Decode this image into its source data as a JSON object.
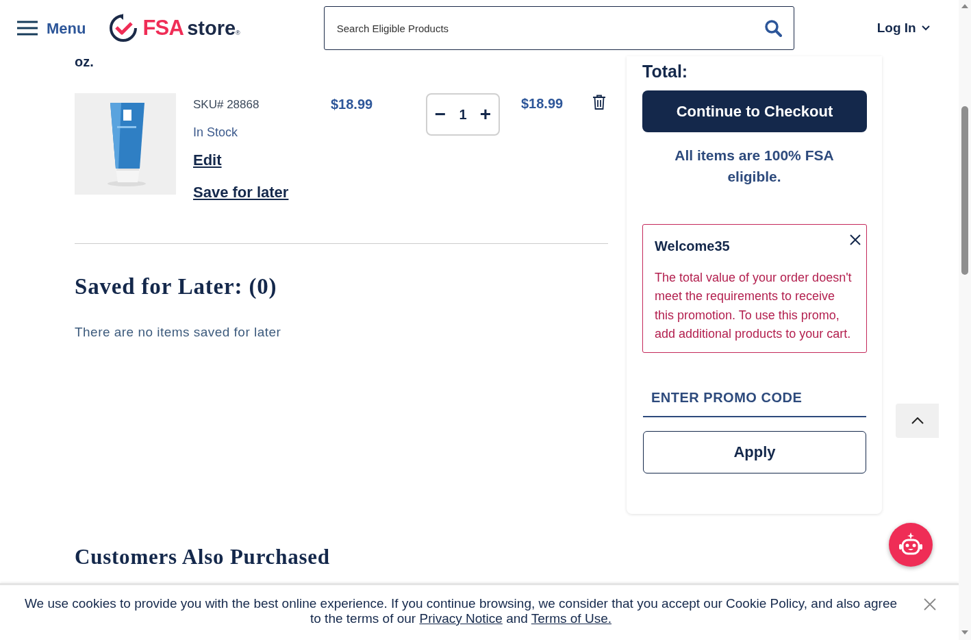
{
  "header": {
    "menu_label": "Menu",
    "logo": {
      "brand": "FSA",
      "word": "store",
      "mark": "®"
    },
    "search": {
      "placeholder": "Search Eligible Products"
    },
    "login_label": "Log In"
  },
  "cart": {
    "title_tail": "oz.",
    "items": [
      {
        "sku": "SKU# 28868",
        "stock": "In Stock",
        "edit": "Edit",
        "save_for_later": "Save for later",
        "price": "$18.99",
        "quantity": "1",
        "decrement": "−",
        "increment": "+",
        "total": "$18.99"
      }
    ]
  },
  "saved_for_later": {
    "title": "Saved for Later: (0)",
    "empty_message": "There are no items saved for later"
  },
  "related": {
    "title": "Customers Also Purchased"
  },
  "summary": {
    "total_label": "Total:",
    "checkout_button": "Continue to Checkout",
    "eligibility_note": "All items are 100% FSA eligible.",
    "promo_alert": {
      "code": "Welcome35",
      "message": "The total value of your order doesn't meet the requirements to receive this promotion. To use this promo, add additional products to your cart."
    },
    "promo_field": {
      "placeholder": "ENTER PROMO CODE"
    },
    "apply_button": "Apply"
  },
  "cookie_banner": {
    "parts": [
      {
        "kind": "text",
        "text": "We use cookies to provide you with the best online experience. If you continue browsing, we consider that you accept our Cookie Policy, and also agree to the terms of our "
      },
      {
        "kind": "link",
        "text": "Privacy Notice"
      },
      {
        "kind": "text",
        "text": " and "
      },
      {
        "kind": "link",
        "text": "Terms of Use."
      }
    ]
  }
}
